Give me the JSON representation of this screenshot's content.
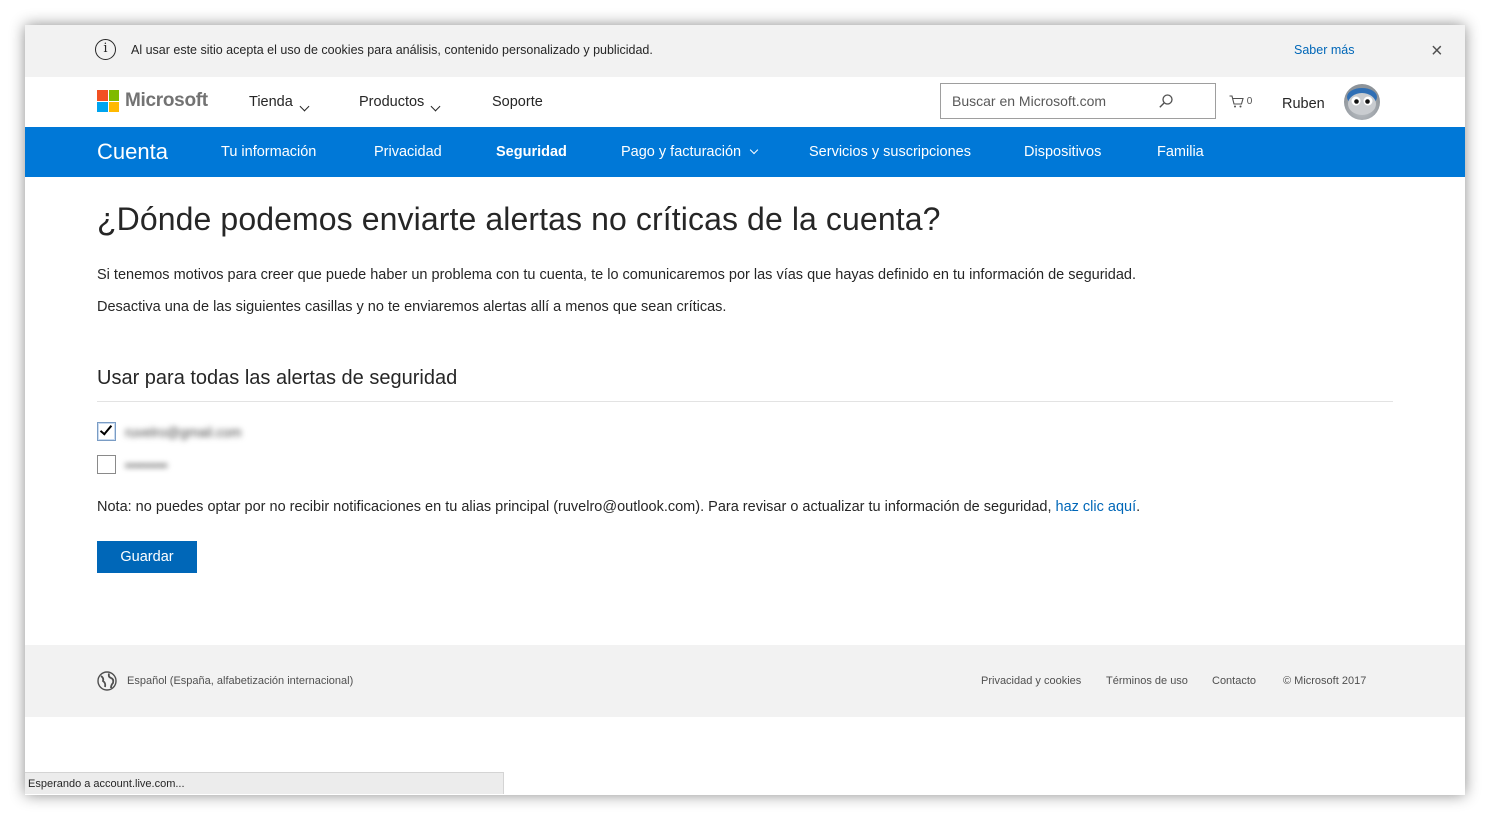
{
  "cookie_bar": {
    "message": "Al usar este sitio acepta el uso de cookies para análisis, contenido personalizado y publicidad.",
    "more_link": "Saber más",
    "close_symbol": "×"
  },
  "header": {
    "logo_text": "Microsoft",
    "nav": [
      {
        "label": "Tienda"
      },
      {
        "label": "Productos"
      },
      {
        "label": "Soporte"
      }
    ],
    "search_placeholder": "Buscar en Microsoft.com",
    "cart_count": "0",
    "user_name": "Ruben"
  },
  "account_nav": {
    "brand": "Cuenta",
    "items": [
      {
        "label": "Tu información"
      },
      {
        "label": "Privacidad"
      },
      {
        "label": "Seguridad"
      },
      {
        "label": "Pago y facturación"
      },
      {
        "label": "Servicios y suscripciones"
      },
      {
        "label": "Dispositivos"
      },
      {
        "label": "Familia"
      }
    ],
    "active": "Seguridad"
  },
  "main": {
    "title": "¿Dónde podemos enviarte alertas no críticas de la cuenta?",
    "paragraph1": "Si tenemos motivos para creer que puede haber un problema con tu cuenta, te lo comunicaremos por las vías que hayas definido en tu información de seguridad.",
    "paragraph2": "Desactiva una de las siguientes casillas y no te enviaremos alertas allí a menos que sean críticas.",
    "section_title": "Usar para todas las alertas de seguridad",
    "options": [
      {
        "label": "ruvelro@gmail.com",
        "checked": true
      },
      {
        "label": "•••••••••",
        "checked": false
      }
    ],
    "note_text": "Nota: no puedes optar por no recibir notificaciones en tu alias principal (ruvelro@outlook.com). Para revisar o actualizar tu información de seguridad, ",
    "note_link": "haz clic aquí",
    "note_end": ".",
    "save_button": "Guardar"
  },
  "footer": {
    "language": "Español (España, alfabetización internacional)",
    "links": [
      {
        "label": "Privacidad y cookies"
      },
      {
        "label": "Términos de uso"
      },
      {
        "label": "Contacto"
      }
    ],
    "copyright": "© Microsoft 2017"
  },
  "status_bar": {
    "text": "Esperando a account.live.com..."
  },
  "colors": {
    "accent_blue": "#0078d7",
    "link_blue": "#0067b8",
    "logo_red": "#f25022",
    "logo_green": "#7fba00",
    "logo_blue": "#00a4ef",
    "logo_yellow": "#ffb900"
  }
}
